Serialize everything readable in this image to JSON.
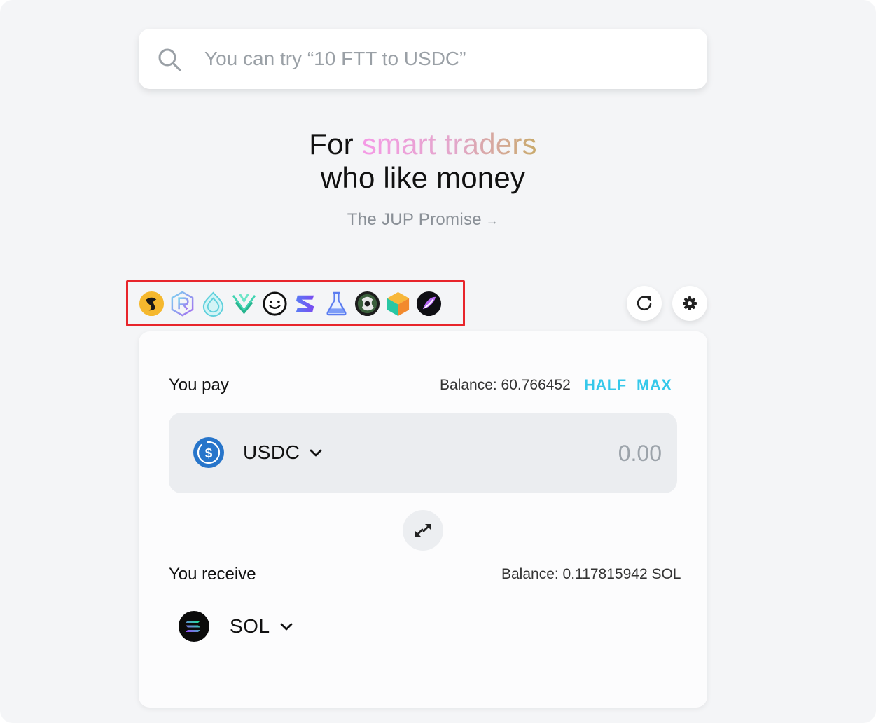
{
  "search": {
    "placeholder": "You can try “10 FTT to USDC”"
  },
  "hero": {
    "line1_prefix": "For",
    "line1_highlight": "smart traders",
    "line2": "who like money",
    "promise_link": "The JUP Promise",
    "promise_arrow": "→"
  },
  "dex_icons": [
    "saber-icon",
    "raydium-icon",
    "orca-icon",
    "aldrin-icon",
    "smiley-dex-icon",
    "serum-icon",
    "lifinity-icon",
    "mercurial-icon",
    "cube-dex-icon",
    "cykura-icon"
  ],
  "toolbar": {
    "refresh_icon": "refresh-icon",
    "settings_icon": "gear-icon"
  },
  "swap": {
    "pay": {
      "label": "You pay",
      "balance": "Balance: 60.766452",
      "half_label": "HALF",
      "max_label": "MAX",
      "token": "USDC",
      "amount_placeholder": "0.00"
    },
    "flip_icon": "swap-arrows-icon",
    "receive": {
      "label": "You receive",
      "balance": "Balance: 0.117815942 SOL",
      "token": "SOL"
    }
  },
  "colors": {
    "background": "#f4f5f7",
    "accent_cyan": "#35c8ea",
    "highlight_border": "#e8252b",
    "usdc_blue": "#2775ca"
  }
}
